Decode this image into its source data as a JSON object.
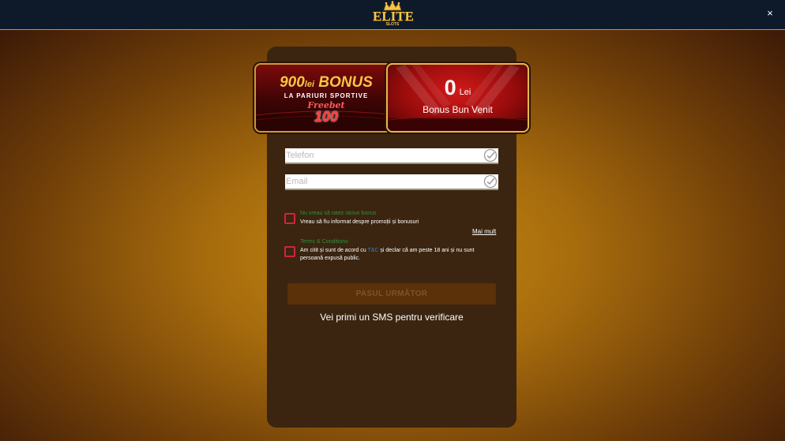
{
  "header": {
    "logo_text": "ELITE",
    "logo_sub": "SLOTS",
    "close_label": "×"
  },
  "promo": {
    "left": {
      "amount": "900",
      "currency": "lei",
      "bonus_word": "BONUS",
      "subtitle": "LA PARIURI SPORTIVE",
      "freebet_script": "Freebet",
      "freebet_amount": "100"
    },
    "right": {
      "amount": "0",
      "currency": "Lei",
      "label": "Bonus Bun Venit"
    }
  },
  "form": {
    "phone_placeholder": "Telefon",
    "email_placeholder": "Email",
    "bonus_opt_title": "Nu vreau să ratez niciun bonus",
    "bonus_opt_desc": "Vreau să fiu informat despre promoții și bonusuri",
    "more_label": "Mai mult",
    "terms_title": "Terms & Conditions",
    "terms_desc_before": "Am citit și sunt de acord cu ",
    "terms_link": "T&C",
    "terms_desc_after": " și declar că am peste 18 ani și nu sunt persoană expusă public.",
    "next_label": "PASUL URMĂTOR",
    "sms_note": "Vei primi un SMS pentru verificare"
  },
  "colors": {
    "checkbox_border": "#d2243b",
    "option_title": "#2f8f3a",
    "link": "#2b7fd6",
    "button_bg": "#5a3108",
    "panel_bg": "#3b2510"
  }
}
